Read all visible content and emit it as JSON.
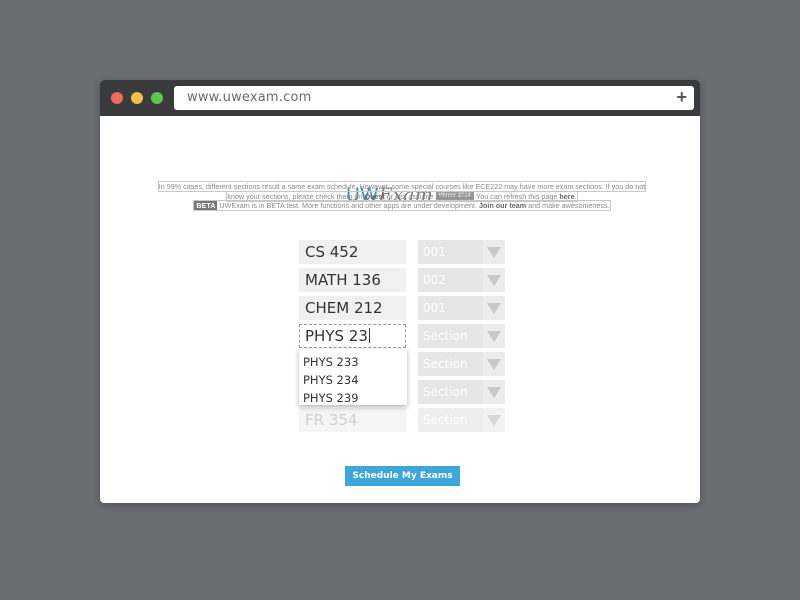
{
  "browser": {
    "url": "www.uwexam.com",
    "new_tab_symbol": "+"
  },
  "logo": {
    "uw": "UW",
    "exam": "Exam",
    "badge": "Winter 2014"
  },
  "notice": {
    "line1": "In 99% cases, different sections result a same exam schedule. However, some special courses like ECE222 may have more exam sections. If you do not",
    "line2a": "know your sections, please check them on ",
    "line2b": "Quest",
    "line2c": " or just assume section 001. You can refresh this page ",
    "line2d": "here",
    "line2e": ".",
    "beta_tag": "BETA",
    "line3a": " UWExam is in BETA test. More functions and other apps are under development. ",
    "line3b": "Join our team",
    "line3c": " and make awesomeness."
  },
  "courses": [
    {
      "course": "CS 452",
      "section": "001"
    },
    {
      "course": "MATH 136",
      "section": "002"
    },
    {
      "course": "CHEM 212",
      "section": "001"
    },
    {
      "course": "PHYS 23",
      "section": "Section"
    },
    {
      "course": "",
      "section": "Section"
    },
    {
      "course": "",
      "section": "Section"
    },
    {
      "course": "FR 354",
      "section": "Section"
    }
  ],
  "dropdown": {
    "options": [
      "PHYS 233",
      "PHYS 234",
      "PHYS 239"
    ]
  },
  "submit_label": "Schedule My Exams"
}
